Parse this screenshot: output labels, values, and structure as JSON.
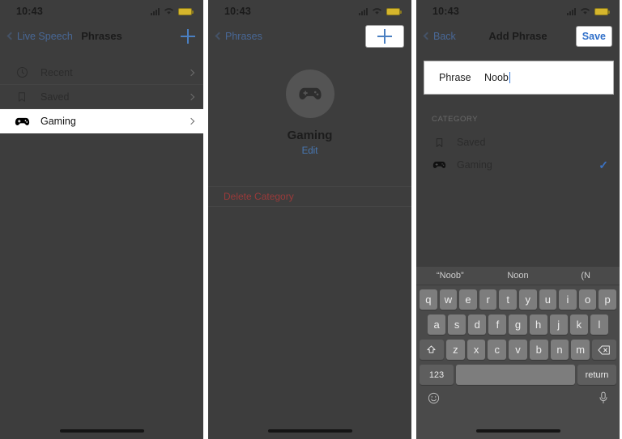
{
  "status": {
    "time": "10:43",
    "battery_color": "#d6b62c",
    "icons": [
      "cellular-signal-icon",
      "wifi-icon",
      "battery-icon"
    ]
  },
  "panel1": {
    "nav": {
      "back_label": "Live Speech",
      "title": "Phrases",
      "add_label": "+"
    },
    "rows": [
      {
        "label": "Recent",
        "icon": "clock-icon",
        "selected": false
      },
      {
        "label": "Saved",
        "icon": "bookmark-icon",
        "selected": false
      },
      {
        "label": "Gaming",
        "icon": "gamepad-icon",
        "selected": true
      }
    ]
  },
  "panel2": {
    "nav": {
      "back_label": "Phrases",
      "title": "",
      "add_label": "+"
    },
    "hero": {
      "name": "Gaming",
      "edit_label": "Edit",
      "avatar_icon": "gamepad-icon"
    },
    "delete_label": "Delete Category"
  },
  "panel3": {
    "nav": {
      "back_label": "Back",
      "title": "Add Phrase",
      "save_label": "Save"
    },
    "field": {
      "label": "Phrase",
      "value": "Noob"
    },
    "section_header": "CATEGORY",
    "categories": [
      {
        "label": "Saved",
        "icon": "bookmark-icon",
        "checked": false
      },
      {
        "label": "Gaming",
        "icon": "gamepad-icon",
        "checked": true,
        "check_glyph": "✓"
      }
    ],
    "keyboard": {
      "predictions": [
        "“Noob”",
        "Noon",
        "(N"
      ],
      "row1": [
        "q",
        "w",
        "e",
        "r",
        "t",
        "y",
        "u",
        "i",
        "o",
        "p"
      ],
      "row2": [
        "a",
        "s",
        "d",
        "f",
        "g",
        "h",
        "j",
        "k",
        "l"
      ],
      "row3": [
        "z",
        "x",
        "c",
        "v",
        "b",
        "n",
        "m"
      ],
      "shift_icon": "shift-icon",
      "backspace_icon": "backspace-icon",
      "numbers_label": "123",
      "space_label": "",
      "return_label": "return",
      "emoji_icon": "emoji-icon",
      "mic_icon": "microphone-icon"
    }
  }
}
